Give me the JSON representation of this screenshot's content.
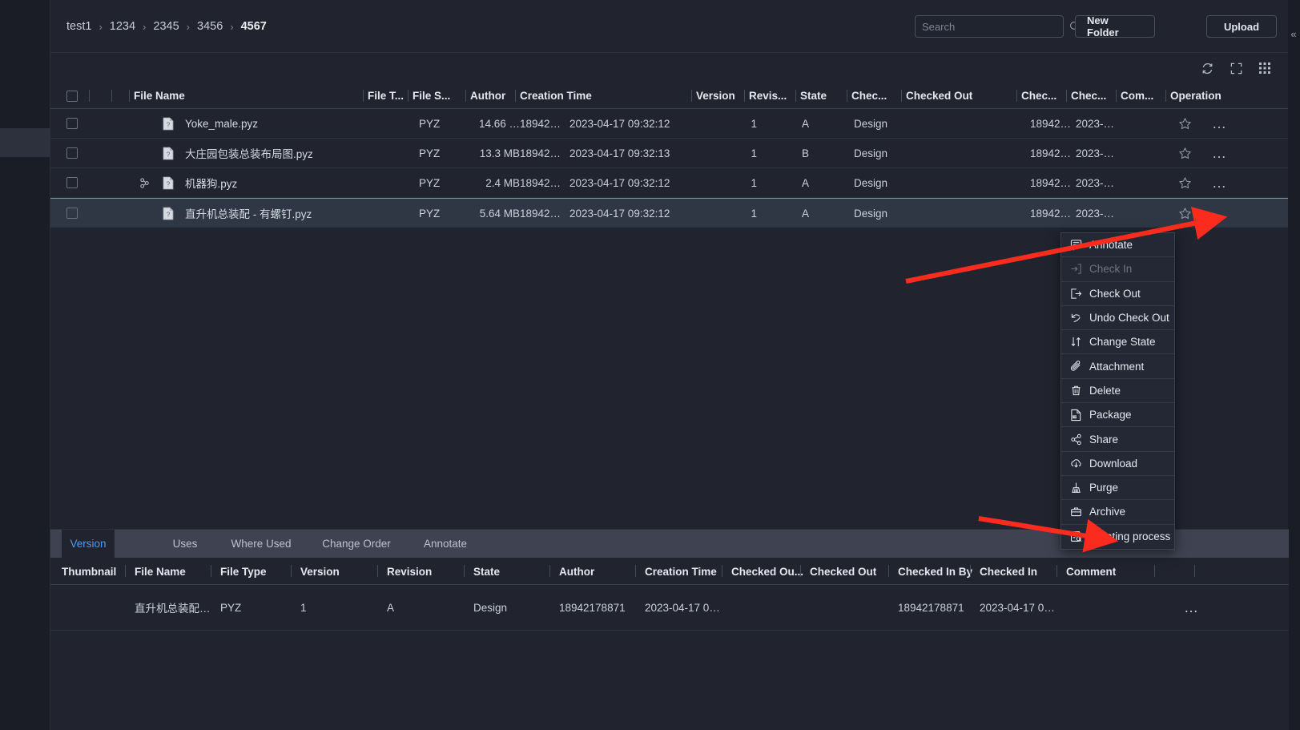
{
  "breadcrumb": {
    "items": [
      "test1",
      "1234",
      "2345",
      "3456",
      "4567"
    ],
    "separator": "›"
  },
  "toolbar": {
    "search_placeholder": "Search",
    "search_value": "",
    "new_folder_label": "New Folder",
    "upload_label": "Upload",
    "icons": [
      "refresh-icon",
      "fullscreen-icon",
      "grid-view-icon"
    ],
    "collapse_label": "«"
  },
  "file_table": {
    "columns": [
      "",
      "",
      "",
      "File Name",
      "File T...",
      "File S...",
      "Author",
      "Creation Time",
      "Version",
      "Revis...",
      "State",
      "Chec...",
      "Checked Out",
      "Chec...",
      "Chec...",
      "Com...",
      "Operation"
    ],
    "rows": [
      {
        "name": "Yoke_male.pyz",
        "file_type": "PYZ",
        "file_size": "14.66 …",
        "author": "18942…",
        "creation_time": "2023-04-17 09:32:12",
        "version": "1",
        "revision": "A",
        "state": "Design",
        "checked": "",
        "checked_out": "",
        "checked_in_by": "18942…",
        "checked_in": "2023-…",
        "comment": "",
        "has_link_icon": false,
        "selected": false
      },
      {
        "name": "大庄园包装总装布局图.pyz",
        "file_type": "PYZ",
        "file_size": "13.3 MB",
        "author": "18942…",
        "creation_time": "2023-04-17 09:32:13",
        "version": "1",
        "revision": "B",
        "state": "Design",
        "checked": "",
        "checked_out": "",
        "checked_in_by": "18942…",
        "checked_in": "2023-…",
        "comment": "",
        "has_link_icon": false,
        "selected": false
      },
      {
        "name": "机器狗.pyz",
        "file_type": "PYZ",
        "file_size": "2.4 MB",
        "author": "18942…",
        "creation_time": "2023-04-17 09:32:12",
        "version": "1",
        "revision": "A",
        "state": "Design",
        "checked": "",
        "checked_out": "",
        "checked_in_by": "18942…",
        "checked_in": "2023-…",
        "comment": "",
        "has_link_icon": true,
        "selected": false
      },
      {
        "name": "直升机总装配 - 有螺钉.pyz",
        "file_type": "PYZ",
        "file_size": "5.64 MB",
        "author": "18942…",
        "creation_time": "2023-04-17 09:32:12",
        "version": "1",
        "revision": "A",
        "state": "Design",
        "checked": "",
        "checked_out": "",
        "checked_in_by": "18942…",
        "checked_in": "2023-…",
        "comment": "",
        "has_link_icon": false,
        "selected": true
      }
    ]
  },
  "context_menu": {
    "items": [
      {
        "label": "Annotate",
        "icon": "annotate-icon",
        "disabled": false
      },
      {
        "label": "Check In",
        "icon": "check-in-icon",
        "disabled": true
      },
      {
        "label": "Check Out",
        "icon": "check-out-icon",
        "disabled": false
      },
      {
        "label": "Undo Check Out",
        "icon": "undo-icon",
        "disabled": false
      },
      {
        "label": "Change State",
        "icon": "change-state-icon",
        "disabled": false
      },
      {
        "label": "Attachment",
        "icon": "paperclip-icon",
        "disabled": false
      },
      {
        "label": "Delete",
        "icon": "trash-icon",
        "disabled": false
      },
      {
        "label": "Package",
        "icon": "zip-package-icon",
        "disabled": false
      },
      {
        "label": "Share",
        "icon": "share-icon",
        "disabled": false
      },
      {
        "label": "Download",
        "icon": "download-cloud-icon",
        "disabled": false
      },
      {
        "label": "Purge",
        "icon": "broom-icon",
        "disabled": false
      },
      {
        "label": "Archive",
        "icon": "briefcase-icon",
        "disabled": false
      },
      {
        "label": "Initiating process",
        "icon": "process-icon",
        "disabled": false
      }
    ]
  },
  "detail_panel": {
    "tabs": [
      {
        "label": "Version",
        "active": true
      },
      {
        "label": "Uses",
        "active": false
      },
      {
        "label": "Where Used",
        "active": false
      },
      {
        "label": "Change Order",
        "active": false
      },
      {
        "label": "Annotate",
        "active": false
      }
    ],
    "columns": [
      "Thumbnail",
      "File Name",
      "File Type",
      "Version",
      "Revision",
      "State",
      "Author",
      "Creation Time",
      "Checked Ou...",
      "Checked Out",
      "Checked In By",
      "Checked In",
      "Comment"
    ],
    "rows": [
      {
        "thumbnail": "",
        "file_name": "直升机总装配…",
        "file_type": "PYZ",
        "version": "1",
        "revision": "A",
        "state": "Design",
        "author": "18942178871",
        "creation_time": "2023-04-17 0…",
        "checked_out_by": "",
        "checked_out": "",
        "checked_in_by": "18942178871",
        "checked_in": "2023-04-17 0…",
        "comment": ""
      }
    ]
  },
  "colors": {
    "bg": "#1b1d26",
    "panel": "#21242f",
    "accent": "#4d9bf0",
    "selected_row": "#2f3644",
    "arrow": "#fb2c1e",
    "menu_bg": "#242835"
  }
}
